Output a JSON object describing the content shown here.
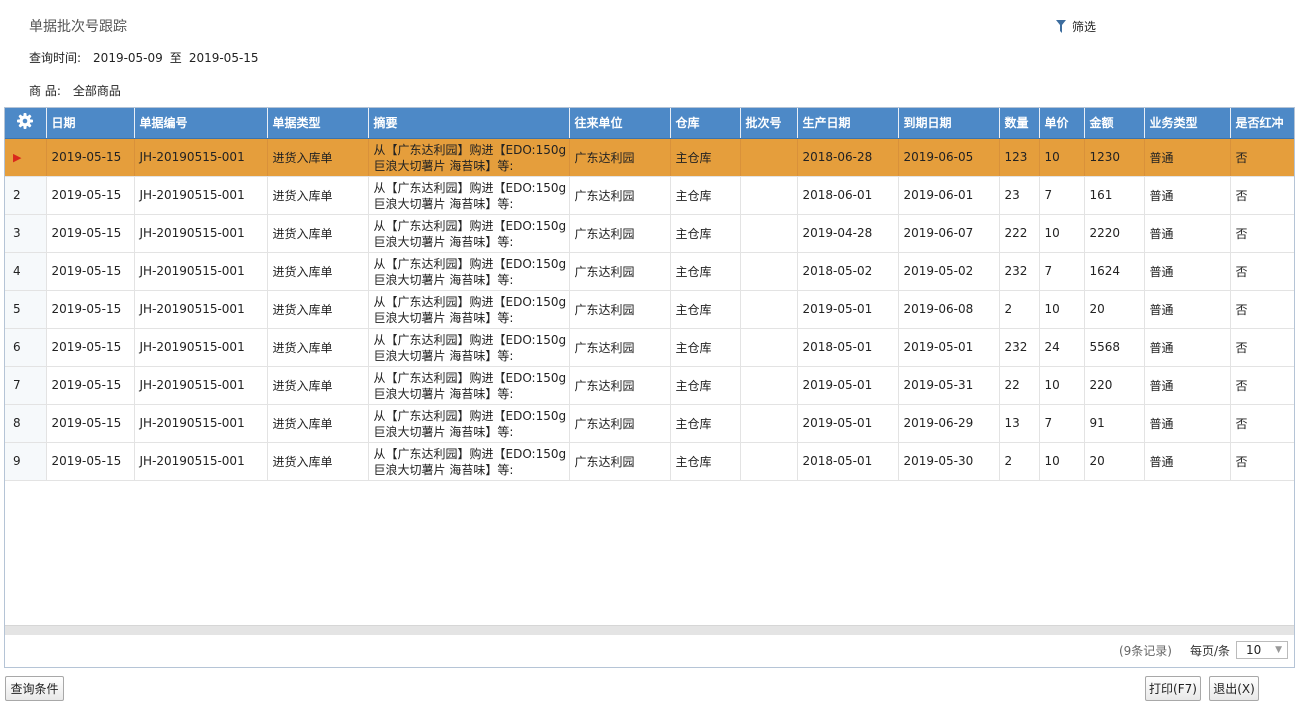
{
  "page_title": "单据批次号跟踪",
  "filter": {
    "label": "筛选"
  },
  "query": {
    "time_label": "查询时间:",
    "time_from": "2019-05-09",
    "time_sep": "至",
    "time_to": "2019-05-15",
    "goods_label": "商 品:",
    "goods_value": "全部商品"
  },
  "grid": {
    "columns": [
      "日期",
      "单据编号",
      "单据类型",
      "摘要",
      "往来单位",
      "仓库",
      "批次号",
      "生产日期",
      "到期日期",
      "数量",
      "单价",
      "金额",
      "业务类型",
      "是否红冲"
    ],
    "rows": [
      {
        "idx": "",
        "date": "2019-05-15",
        "no": "JH-20190515-001",
        "type": "进货入库单",
        "summary": "从【广东达利园】购进【EDO:150g巨浪大切薯片 海苔味】等:",
        "partner": "广东达利园",
        "warehouse": "主仓库",
        "batch": "",
        "prod_date": "2018-06-28",
        "exp_date": "2019-06-05",
        "qty": "123",
        "price": "10",
        "amount": "1230",
        "biz_type": "普通",
        "red": "否"
      },
      {
        "idx": "2",
        "date": "2019-05-15",
        "no": "JH-20190515-001",
        "type": "进货入库单",
        "summary": "从【广东达利园】购进【EDO:150g巨浪大切薯片 海苔味】等:",
        "partner": "广东达利园",
        "warehouse": "主仓库",
        "batch": "",
        "prod_date": "2018-06-01",
        "exp_date": "2019-06-01",
        "qty": "23",
        "price": "7",
        "amount": "161",
        "biz_type": "普通",
        "red": "否"
      },
      {
        "idx": "3",
        "date": "2019-05-15",
        "no": "JH-20190515-001",
        "type": "进货入库单",
        "summary": "从【广东达利园】购进【EDO:150g巨浪大切薯片 海苔味】等:",
        "partner": "广东达利园",
        "warehouse": "主仓库",
        "batch": "",
        "prod_date": "2019-04-28",
        "exp_date": "2019-06-07",
        "qty": "222",
        "price": "10",
        "amount": "2220",
        "biz_type": "普通",
        "red": "否"
      },
      {
        "idx": "4",
        "date": "2019-05-15",
        "no": "JH-20190515-001",
        "type": "进货入库单",
        "summary": "从【广东达利园】购进【EDO:150g巨浪大切薯片 海苔味】等:",
        "partner": "广东达利园",
        "warehouse": "主仓库",
        "batch": "",
        "prod_date": "2018-05-02",
        "exp_date": "2019-05-02",
        "qty": "232",
        "price": "7",
        "amount": "1624",
        "biz_type": "普通",
        "red": "否"
      },
      {
        "idx": "5",
        "date": "2019-05-15",
        "no": "JH-20190515-001",
        "type": "进货入库单",
        "summary": "从【广东达利园】购进【EDO:150g巨浪大切薯片 海苔味】等:",
        "partner": "广东达利园",
        "warehouse": "主仓库",
        "batch": "",
        "prod_date": "2019-05-01",
        "exp_date": "2019-06-08",
        "qty": "2",
        "price": "10",
        "amount": "20",
        "biz_type": "普通",
        "red": "否"
      },
      {
        "idx": "6",
        "date": "2019-05-15",
        "no": "JH-20190515-001",
        "type": "进货入库单",
        "summary": "从【广东达利园】购进【EDO:150g巨浪大切薯片 海苔味】等:",
        "partner": "广东达利园",
        "warehouse": "主仓库",
        "batch": "",
        "prod_date": "2018-05-01",
        "exp_date": "2019-05-01",
        "qty": "232",
        "price": "24",
        "amount": "5568",
        "biz_type": "普通",
        "red": "否"
      },
      {
        "idx": "7",
        "date": "2019-05-15",
        "no": "JH-20190515-001",
        "type": "进货入库单",
        "summary": "从【广东达利园】购进【EDO:150g巨浪大切薯片 海苔味】等:",
        "partner": "广东达利园",
        "warehouse": "主仓库",
        "batch": "",
        "prod_date": "2019-05-01",
        "exp_date": "2019-05-31",
        "qty": "22",
        "price": "10",
        "amount": "220",
        "biz_type": "普通",
        "red": "否"
      },
      {
        "idx": "8",
        "date": "2019-05-15",
        "no": "JH-20190515-001",
        "type": "进货入库单",
        "summary": "从【广东达利园】购进【EDO:150g巨浪大切薯片 海苔味】等:",
        "partner": "广东达利园",
        "warehouse": "主仓库",
        "batch": "",
        "prod_date": "2019-05-01",
        "exp_date": "2019-06-29",
        "qty": "13",
        "price": "7",
        "amount": "91",
        "biz_type": "普通",
        "red": "否"
      },
      {
        "idx": "9",
        "date": "2019-05-15",
        "no": "JH-20190515-001",
        "type": "进货入库单",
        "summary": "从【广东达利园】购进【EDO:150g巨浪大切薯片 海苔味】等:",
        "partner": "广东达利园",
        "warehouse": "主仓库",
        "batch": "",
        "prod_date": "2018-05-01",
        "exp_date": "2019-05-30",
        "qty": "2",
        "price": "10",
        "amount": "20",
        "biz_type": "普通",
        "red": "否"
      }
    ]
  },
  "pager": {
    "count_text": "(9条记录)",
    "per_page_label": "每页/条",
    "page_size": "10"
  },
  "buttons": {
    "query": "查询条件",
    "print": "打印(F7)",
    "exit": "退出(X)"
  },
  "colors": {
    "header_bg": "#4d89c7",
    "selected_row": "#e59e3c",
    "arrow": "#d9281c"
  },
  "icons": {
    "settings": "gear-icon",
    "filter": "funnel-icon",
    "current_row": "arrow-right-icon"
  }
}
